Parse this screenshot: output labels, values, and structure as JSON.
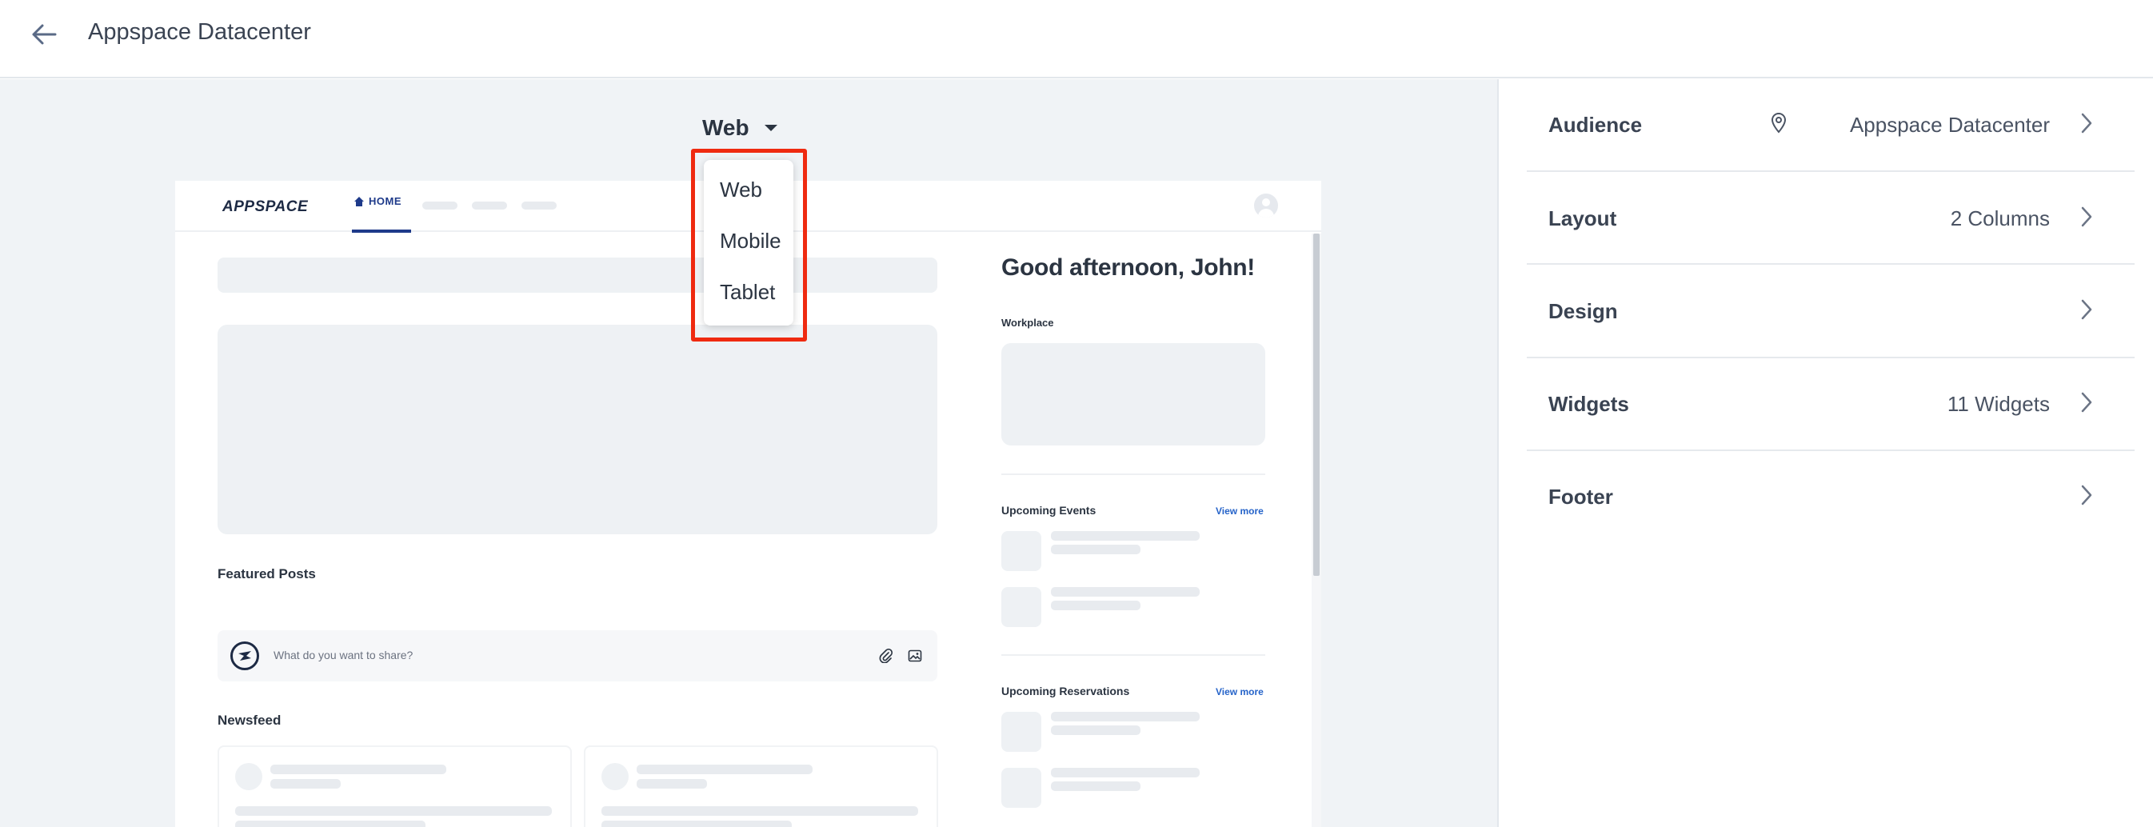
{
  "header": {
    "title": "Appspace Datacenter"
  },
  "device": {
    "selected": "Web",
    "options": [
      "Web",
      "Mobile",
      "Tablet"
    ]
  },
  "preview": {
    "logo": "APPSPACE",
    "nav_home": "HOME",
    "greeting": "Good afternoon, John!",
    "workplace_label": "Workplace",
    "upcoming_events": "Upcoming Events",
    "upcoming_reservations": "Upcoming Reservations",
    "view_more": "View more",
    "featured_posts": "Featured Posts",
    "share_placeholder": "What do you want to share?",
    "newsfeed": "Newsfeed"
  },
  "panel": {
    "rows": [
      {
        "label": "Audience",
        "value": "Appspace Datacenter",
        "icon": "location-pin-icon"
      },
      {
        "label": "Layout",
        "value": "2 Columns"
      },
      {
        "label": "Design",
        "value": ""
      },
      {
        "label": "Widgets",
        "value": "11 Widgets"
      },
      {
        "label": "Footer",
        "value": ""
      }
    ]
  },
  "colors": {
    "accent": "#1e3a8a",
    "link": "#2563c9",
    "highlight": "#ef2a10",
    "canvas_bg": "#f0f3f6"
  }
}
